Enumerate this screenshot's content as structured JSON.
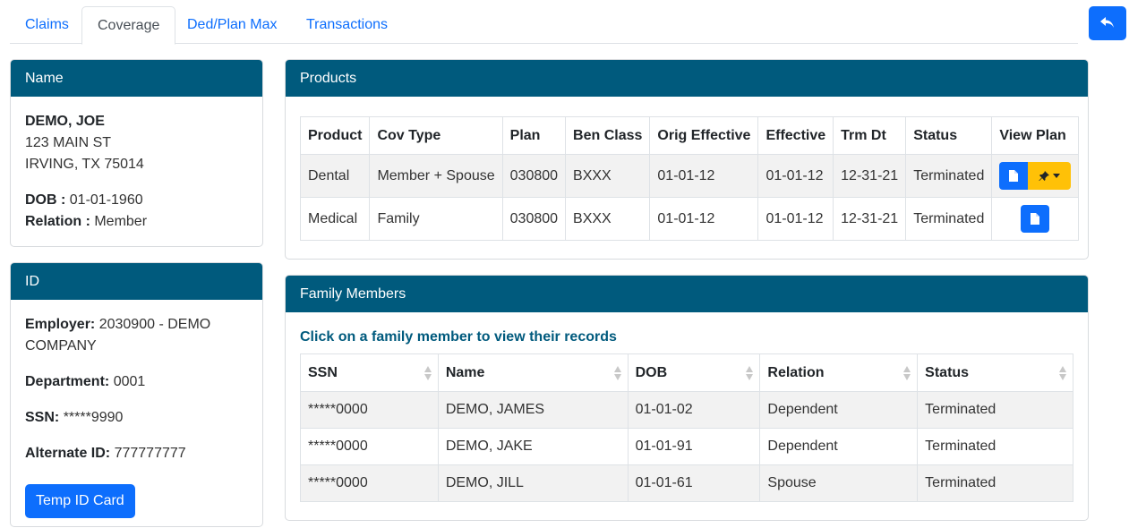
{
  "tabs": {
    "claims": "Claims",
    "coverage": "Coverage",
    "ded_plan_max": "Ded/Plan Max",
    "transactions": "Transactions",
    "active": "Coverage"
  },
  "name_card": {
    "header": "Name",
    "name": "DEMO, JOE",
    "address1": "123 MAIN ST",
    "address2": "IRVING, TX 75014",
    "dob_label": "DOB :",
    "dob": "01-01-1960",
    "relation_label": "Relation :",
    "relation": "Member"
  },
  "id_card": {
    "header": "ID",
    "employer_label": "Employer:",
    "employer": "2030900 - DEMO COMPANY",
    "department_label": "Department:",
    "department": "0001",
    "ssn_label": "SSN:",
    "ssn": "*****9990",
    "alternate_label": "Alternate ID:",
    "alternate": "777777777",
    "temp_button": "Temp ID Card"
  },
  "products": {
    "header": "Products",
    "columns": [
      "Product",
      "Cov Type",
      "Plan",
      "Ben Class",
      "Orig Effective",
      "Effective",
      "Trm Dt",
      "Status",
      "View Plan"
    ],
    "rows": [
      [
        "Dental",
        "Member + Spouse",
        "030800",
        "BXXX",
        "01-01-12",
        "01-01-12",
        "12-31-21",
        "Terminated"
      ],
      [
        "Medical",
        "Family",
        "030800",
        "BXXX",
        "01-01-12",
        "01-01-12",
        "12-31-21",
        "Terminated"
      ]
    ]
  },
  "family": {
    "header": "Family Members",
    "hint": "Click on a family member to view their records",
    "columns": [
      "SSN",
      "Name",
      "DOB",
      "Relation",
      "Status"
    ],
    "rows": [
      [
        "*****0000",
        "DEMO, JAMES",
        "01-01-02",
        "Dependent",
        "Terminated"
      ],
      [
        "*****0000",
        "DEMO, JAKE",
        "01-01-91",
        "Dependent",
        "Terminated"
      ],
      [
        "*****0000",
        "DEMO, JILL",
        "01-01-61",
        "Spouse",
        "Terminated"
      ]
    ]
  },
  "colors": {
    "header_bg": "#005a7d",
    "primary": "#0d6efd",
    "warning": "#ffc107"
  }
}
